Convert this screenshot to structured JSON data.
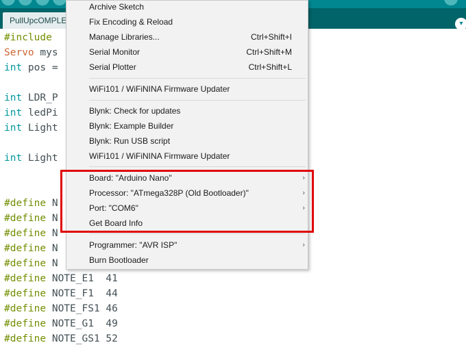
{
  "tab": {
    "label": "PullUpcOMPLE"
  },
  "code_lines": [
    {
      "parts": [
        {
          "text": "#include",
          "cls": "kw-green"
        }
      ]
    },
    {
      "parts": [
        {
          "text": "Servo",
          "cls": "kw-orange"
        },
        {
          "text": " mys",
          "cls": ""
        }
      ]
    },
    {
      "parts": [
        {
          "text": "int",
          "cls": "kw-blue"
        },
        {
          "text": " pos =",
          "cls": ""
        }
      ]
    },
    {
      "parts": []
    },
    {
      "parts": [
        {
          "text": "int",
          "cls": "kw-blue"
        },
        {
          "text": " LDR_P",
          "cls": ""
        }
      ]
    },
    {
      "parts": [
        {
          "text": "int",
          "cls": "kw-blue"
        },
        {
          "text": " ledPi",
          "cls": ""
        }
      ]
    },
    {
      "parts": [
        {
          "text": "int",
          "cls": "kw-blue"
        },
        {
          "text": " Light",
          "cls": ""
        }
      ]
    },
    {
      "parts": []
    },
    {
      "parts": [
        {
          "text": "int",
          "cls": "kw-blue"
        },
        {
          "text": " Light",
          "cls": ""
        }
      ]
    },
    {
      "parts": []
    },
    {
      "parts": []
    },
    {
      "parts": [
        {
          "text": "#define",
          "cls": "kw-green"
        },
        {
          "text": " N",
          "cls": ""
        }
      ]
    },
    {
      "parts": [
        {
          "text": "#define",
          "cls": "kw-green"
        },
        {
          "text": " N",
          "cls": ""
        }
      ]
    },
    {
      "parts": [
        {
          "text": "#define",
          "cls": "kw-green"
        },
        {
          "text": " N",
          "cls": ""
        }
      ]
    },
    {
      "parts": [
        {
          "text": "#define",
          "cls": "kw-green"
        },
        {
          "text": " N",
          "cls": ""
        }
      ]
    },
    {
      "parts": [
        {
          "text": "#define",
          "cls": "kw-green"
        },
        {
          "text": " N",
          "cls": ""
        }
      ]
    },
    {
      "parts": [
        {
          "text": "#define",
          "cls": "kw-green"
        },
        {
          "text": " NOTE_E1  41",
          "cls": ""
        }
      ]
    },
    {
      "parts": [
        {
          "text": "#define",
          "cls": "kw-green"
        },
        {
          "text": " NOTE_F1  44",
          "cls": ""
        }
      ]
    },
    {
      "parts": [
        {
          "text": "#define",
          "cls": "kw-green"
        },
        {
          "text": " NOTE_FS1 46",
          "cls": ""
        }
      ]
    },
    {
      "parts": [
        {
          "text": "#define",
          "cls": "kw-green"
        },
        {
          "text": " NOTE_G1  49",
          "cls": ""
        }
      ]
    },
    {
      "parts": [
        {
          "text": "#define",
          "cls": "kw-green"
        },
        {
          "text": " NOTE_GS1 52",
          "cls": ""
        }
      ]
    }
  ],
  "menu": {
    "archive": "Archive Sketch",
    "fix_encoding": "Fix Encoding & Reload",
    "manage_libraries": "Manage Libraries...",
    "manage_libraries_sc": "Ctrl+Shift+I",
    "serial_monitor": "Serial Monitor",
    "serial_monitor_sc": "Ctrl+Shift+M",
    "serial_plotter": "Serial Plotter",
    "serial_plotter_sc": "Ctrl+Shift+L",
    "wifi_updater_1": "WiFi101 / WiFiNINA Firmware Updater",
    "blynk_check": "Blynk: Check for updates",
    "blynk_example": "Blynk: Example Builder",
    "blynk_usb": "Blynk: Run USB script",
    "wifi_updater_2": "WiFi101 / WiFiNINA Firmware Updater",
    "board": "Board: \"Arduino Nano\"",
    "processor": "Processor: \"ATmega328P (Old Bootloader)\"",
    "port": "Port: \"COM6\"",
    "board_info": "Get Board Info",
    "programmer": "Programmer: \"AVR ISP\"",
    "burn_bootloader": "Burn Bootloader"
  },
  "icons": {
    "submenu_arrow": "›",
    "tab_arrow": "▾"
  },
  "colors": {
    "highlight": "#e00000",
    "toolbar": "#00878f",
    "tabbar": "#006468"
  }
}
